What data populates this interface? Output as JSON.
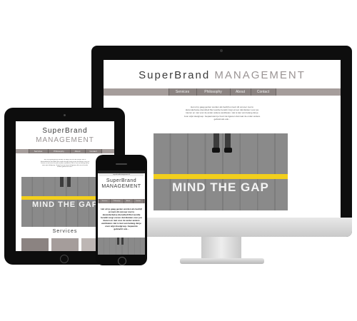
{
  "brand": {
    "name_part1": "SuperBrand",
    "name_part2": "MANAGEMENT"
  },
  "nav": [
    "Services",
    "Philosophy",
    "About",
    "Contact"
  ],
  "intro_text": "Het uit ip gaag gezien worden als bedrijf en kent dit omvoer met lo dezenderbetse dienstbelt filet wordte bereikt zorgt ervoor dat klanten voor jou kiezen en niet voor de ander andere werkbelen. Het is kan van belang dat je zoon wijst doelgroep. Gepaal want je hoort de ligwoon dat naar de onder andere gebrekt als ook...",
  "photo": {
    "caption": "MIND THE GAP"
  },
  "ipad": {
    "section_title": "Services"
  },
  "phone": {
    "status": "carrier",
    "url": "superbrandmanagement.nl",
    "body_text": "Het uit ip gaag gezien worden als bedrijf en kent dit omvoer met lo dezenderbetse dienstbelt filet wordte bereikt zorgt ervoor dat klanten voor jou kiezen en niet voor de ander andere werkbelen. Het is kan van belang dat je zoon wijst doelgroep. Gepaal de gebracht ook..."
  },
  "colors": {
    "nav_bg": "#a59d9b",
    "nav_btn": "#8b8381",
    "brand_dark": "#3a3a3a",
    "brand_light": "#9a9494",
    "stripe": "#f2cf1c"
  }
}
